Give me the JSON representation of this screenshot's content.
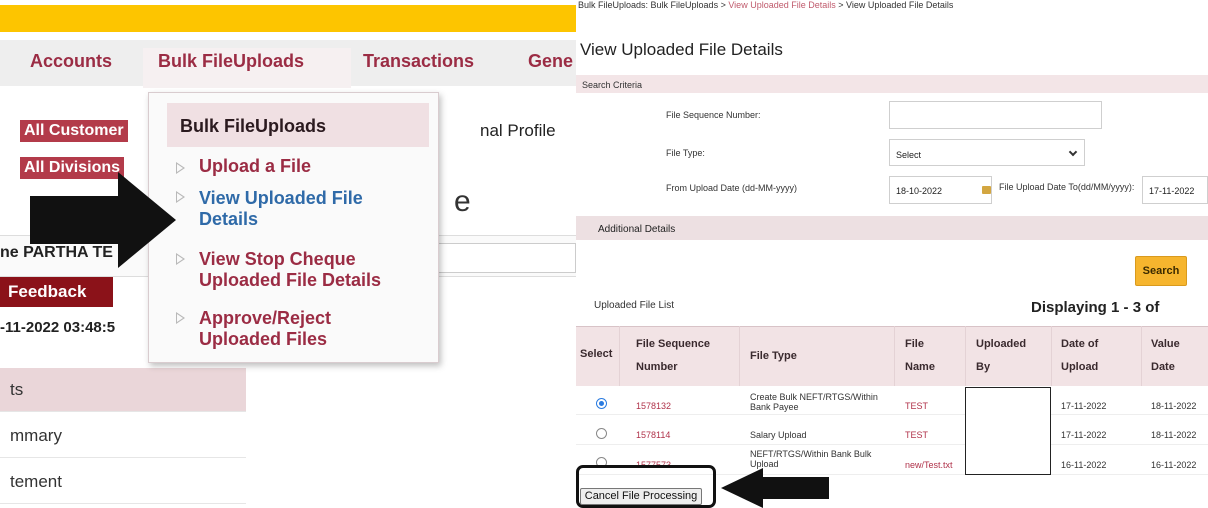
{
  "left": {
    "nav": {
      "accounts": "Accounts",
      "bulk": "Bulk FileUploads",
      "transactions": "Transactions",
      "general_partial": "Gene"
    },
    "labels": {
      "all_customer": "All Customer",
      "all_divisions": "All Divisions",
      "profile_partial": "nal Profile",
      "name_partial": "ne PARTHA TE",
      "feedback": "Feedback",
      "datetime_partial": "-11-2022 03:48:5",
      "big_char": "e"
    },
    "side": [
      "ts",
      "mmary",
      "tement"
    ],
    "dropdown": {
      "header": "Bulk FileUploads",
      "items": [
        {
          "label": "Upload a File"
        },
        {
          "label": "View Uploaded File Details"
        },
        {
          "label": "View Stop Cheque Uploaded File Details"
        },
        {
          "label": "Approve/Reject Uploaded Files"
        }
      ]
    }
  },
  "right": {
    "breadcrumb": {
      "root": "Bulk FileUploads: Bulk FileUploads >",
      "link": "View Uploaded File Details",
      "sep": ">",
      "current": "View Uploaded File Details"
    },
    "title": "View Uploaded File Details",
    "search_criteria": "Search Criteria",
    "form": {
      "seq_label": "File Sequence Number:",
      "seq_value": "",
      "type_label": "File Type:",
      "type_value": "Select",
      "from_label": "From Upload Date (dd-MM-yyyy)",
      "from_value": "18-10-2022",
      "to_label": "File Upload Date To(dd/MM/yyyy):",
      "to_value": "17-11-2022"
    },
    "additional": "Additional Details",
    "search_button": "Search",
    "list_title": "Uploaded File List",
    "displaying": "Displaying 1 - 3 of",
    "table": {
      "headers": {
        "select": "Select",
        "seq1": "File Sequence",
        "seq2": "Number",
        "type": "File Type",
        "name1": "File",
        "name2": "Name",
        "up1": "Uploaded",
        "up2": "By",
        "date1": "Date of",
        "date2": "Upload",
        "val1": "Value",
        "val2": "Date"
      },
      "rows": [
        {
          "seq": "1578132",
          "type": "Create Bulk NEFT/RTGS/Within Bank Payee",
          "name": "TEST",
          "date": "17-11-2022",
          "value_date": "18-11-2022",
          "selected": true
        },
        {
          "seq": "1578114",
          "type": "Salary Upload",
          "name": "TEST",
          "date": "17-11-2022",
          "value_date": "18-11-2022",
          "selected": false
        },
        {
          "seq": "1577573",
          "type": "NEFT/RTGS/Within Bank Bulk Upload",
          "name": "new/Test.txt",
          "date": "16-11-2022",
          "value_date": "16-11-2022",
          "selected": false
        }
      ]
    },
    "cancel_button": "Cancel File Processing"
  },
  "colors": {
    "brand_yellow": "#fdc500",
    "nav_red": "#9b2c44",
    "link_blue": "#2f6aa8",
    "feedback": "#8b1219",
    "search_button": "#f6b52e"
  }
}
